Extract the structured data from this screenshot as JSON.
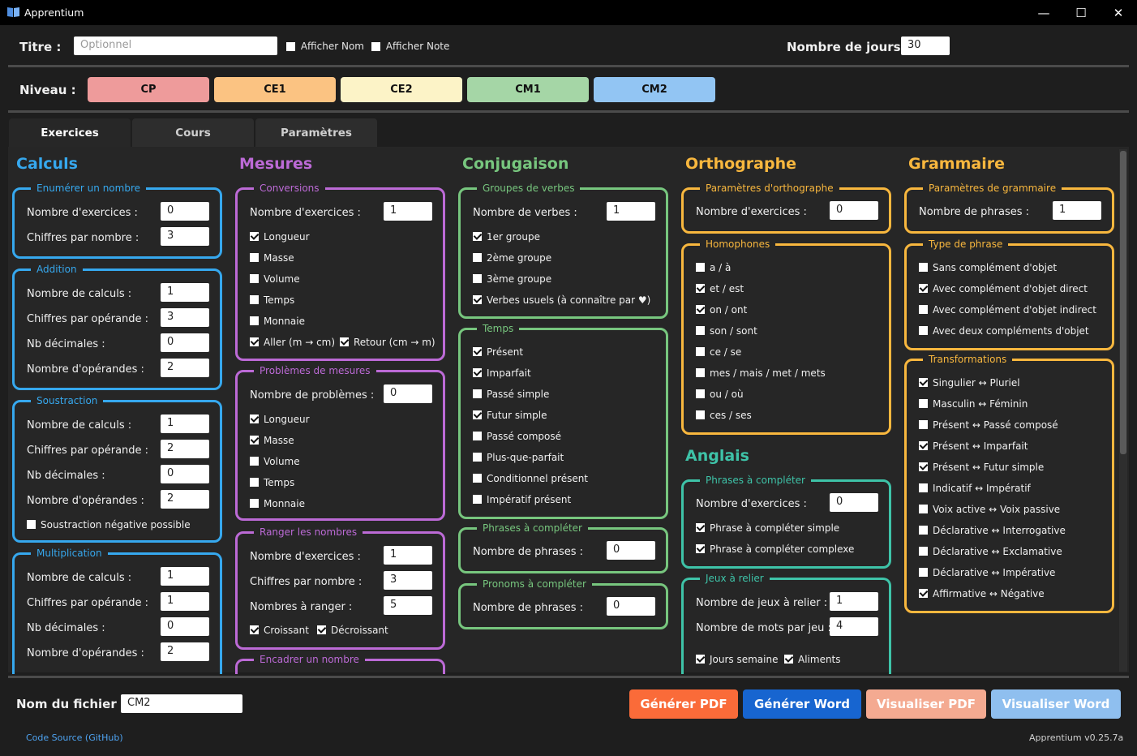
{
  "window": {
    "title": "Apprentium",
    "min": "—",
    "max": "☐",
    "close": "✕"
  },
  "header": {
    "title_label": "Titre :",
    "title_placeholder": "Optionnel",
    "show_name": "Afficher Nom",
    "show_note": "Afficher Note",
    "days_label": "Nombre de jours :",
    "days_value": "30",
    "level_label": "Niveau :"
  },
  "levels": [
    {
      "label": "CP",
      "color": "#ee9b9b"
    },
    {
      "label": "CE1",
      "color": "#fbc382"
    },
    {
      "label": "CE2",
      "color": "#fcf3c7"
    },
    {
      "label": "CM1",
      "color": "#a5d6a6"
    },
    {
      "label": "CM2",
      "color": "#92c5f3"
    }
  ],
  "tabs": [
    "Exercices",
    "Cours",
    "Paramètres"
  ],
  "colors": {
    "calculs": "#36a8ee",
    "mesures": "#bc6ad6",
    "conjugaison": "#77c67e",
    "orthographe": "#f8b73e",
    "anglais": "#3ec3a8",
    "grammaire": "#f8b73e"
  },
  "columns": {
    "calculs": "Calculs",
    "mesures": "Mesures",
    "conjugaison": "Conjugaison",
    "orthographe": "Orthographe",
    "anglais": "Anglais",
    "grammaire": "Grammaire"
  },
  "calculs": {
    "enumerer": {
      "title": "Enumérer un nombre",
      "r1": "Nombre d'exercices :",
      "v1": "0",
      "r2": "Chiffres par nombre :",
      "v2": "3"
    },
    "addition": {
      "title": "Addition",
      "r1": "Nombre de calculs :",
      "v1": "1",
      "r2": "Chiffres par opérande :",
      "v2": "3",
      "r3": "Nb décimales :",
      "v3": "0",
      "r4": "Nombre d'opérandes :",
      "v4": "2"
    },
    "soustraction": {
      "title": "Soustraction",
      "r1": "Nombre de calculs :",
      "v1": "1",
      "r2": "Chiffres par opérande :",
      "v2": "2",
      "r3": "Nb décimales :",
      "v3": "0",
      "r4": "Nombre d'opérandes :",
      "v4": "2",
      "c1": "Soustraction négative possible"
    },
    "multiplication": {
      "title": "Multiplication",
      "r1": "Nombre de calculs :",
      "v1": "1",
      "r2": "Chiffres par opérande :",
      "v2": "1",
      "r3": "Nb décimales :",
      "v3": "0",
      "r4": "Nombre d'opérandes :",
      "v4": "2"
    }
  },
  "mesures": {
    "conversions": {
      "title": "Conversions",
      "r1": "Nombre d'exercices :",
      "v1": "1",
      "c1": "Longueur",
      "c2": "Masse",
      "c3": "Volume",
      "c4": "Temps",
      "c5": "Monnaie",
      "c6": "Aller (m → cm)",
      "c7": "Retour (cm → m)"
    },
    "problemes": {
      "title": "Problèmes de mesures",
      "r1": "Nombre de problèmes :",
      "v1": "0",
      "c1": "Longueur",
      "c2": "Masse",
      "c3": "Volume",
      "c4": "Temps",
      "c5": "Monnaie"
    },
    "ranger": {
      "title": "Ranger les nombres",
      "r1": "Nombre d'exercices :",
      "v1": "1",
      "r2": "Chiffres par nombre :",
      "v2": "3",
      "r3": "Nombres à ranger :",
      "v3": "5",
      "c1": "Croissant",
      "c2": "Décroissant"
    },
    "encadrer": {
      "title": "Encadrer un nombre"
    }
  },
  "conjugaison": {
    "groupes": {
      "title": "Groupes de verbes",
      "r1": "Nombre de verbes :",
      "v1": "1",
      "c1": "1er groupe",
      "c2": "2ème groupe",
      "c3": "3ème groupe",
      "c4": "Verbes usuels (à connaître par ♥)"
    },
    "temps": {
      "title": "Temps",
      "c1": "Présent",
      "c2": "Imparfait",
      "c3": "Passé simple",
      "c4": "Futur simple",
      "c5": "Passé composé",
      "c6": "Plus-que-parfait",
      "c7": "Conditionnel présent",
      "c8": "Impératif présent"
    },
    "phrases": {
      "title": "Phrases à compléter",
      "r1": "Nombre de phrases :",
      "v1": "0"
    },
    "pronoms": {
      "title": "Pronoms à compléter",
      "r1": "Nombre de phrases :",
      "v1": "0"
    }
  },
  "orthographe": {
    "params": {
      "title": "Paramètres d'orthographe",
      "r1": "Nombre d'exercices :",
      "v1": "0"
    },
    "homophones": {
      "title": "Homophones",
      "c1": "a / à",
      "c2": "et / est",
      "c3": "on / ont",
      "c4": "son / sont",
      "c5": "ce / se",
      "c6": "mes / mais / met / mets",
      "c7": "ou / où",
      "c8": "ces / ses"
    }
  },
  "anglais": {
    "phrases": {
      "title": "Phrases à compléter",
      "r1": "Nombre d'exercices :",
      "v1": "0",
      "c1": "Phrase à compléter simple",
      "c2": "Phrase à compléter complexe"
    },
    "jeux": {
      "title": "Jeux à relier",
      "r1": "Nombre de jeux à relier :",
      "v1": "1",
      "r2": "Nombre de mots par jeu :",
      "v2": "4",
      "c1": "Jours semaine",
      "c2": "Aliments"
    }
  },
  "grammaire": {
    "params": {
      "title": "Paramètres de grammaire",
      "r1": "Nombre de phrases :",
      "v1": "1"
    },
    "type": {
      "title": "Type de phrase",
      "c1": "Sans complément d'objet",
      "c2": "Avec complément d'objet direct",
      "c3": "Avec complément d'objet indirect",
      "c4": "Avec deux compléments d'objet"
    },
    "transfo": {
      "title": "Transformations",
      "c1": "Singulier ↔ Pluriel",
      "c2": "Masculin ↔ Féminin",
      "c3": "Présent ↔ Passé composé",
      "c4": "Présent ↔ Imparfait",
      "c5": "Présent ↔ Futur simple",
      "c6": "Indicatif ↔ Impératif",
      "c7": "Voix active ↔ Voix passive",
      "c8": "Déclarative ↔ Interrogative",
      "c9": "Déclarative ↔ Exclamative",
      "c10": "Déclarative ↔ Impérative",
      "c11": "Affirmative ↔ Négative"
    }
  },
  "footer": {
    "file_label": "Nom du fichier :",
    "file_value": "CM2",
    "btn_pdf": "Générer PDF",
    "btn_word": "Générer Word",
    "btn_view_pdf": "Visualiser PDF",
    "btn_view_word": "Visualiser Word",
    "source_link": "Code Source (GitHub)",
    "version": "Apprentium v0.25.7a"
  }
}
